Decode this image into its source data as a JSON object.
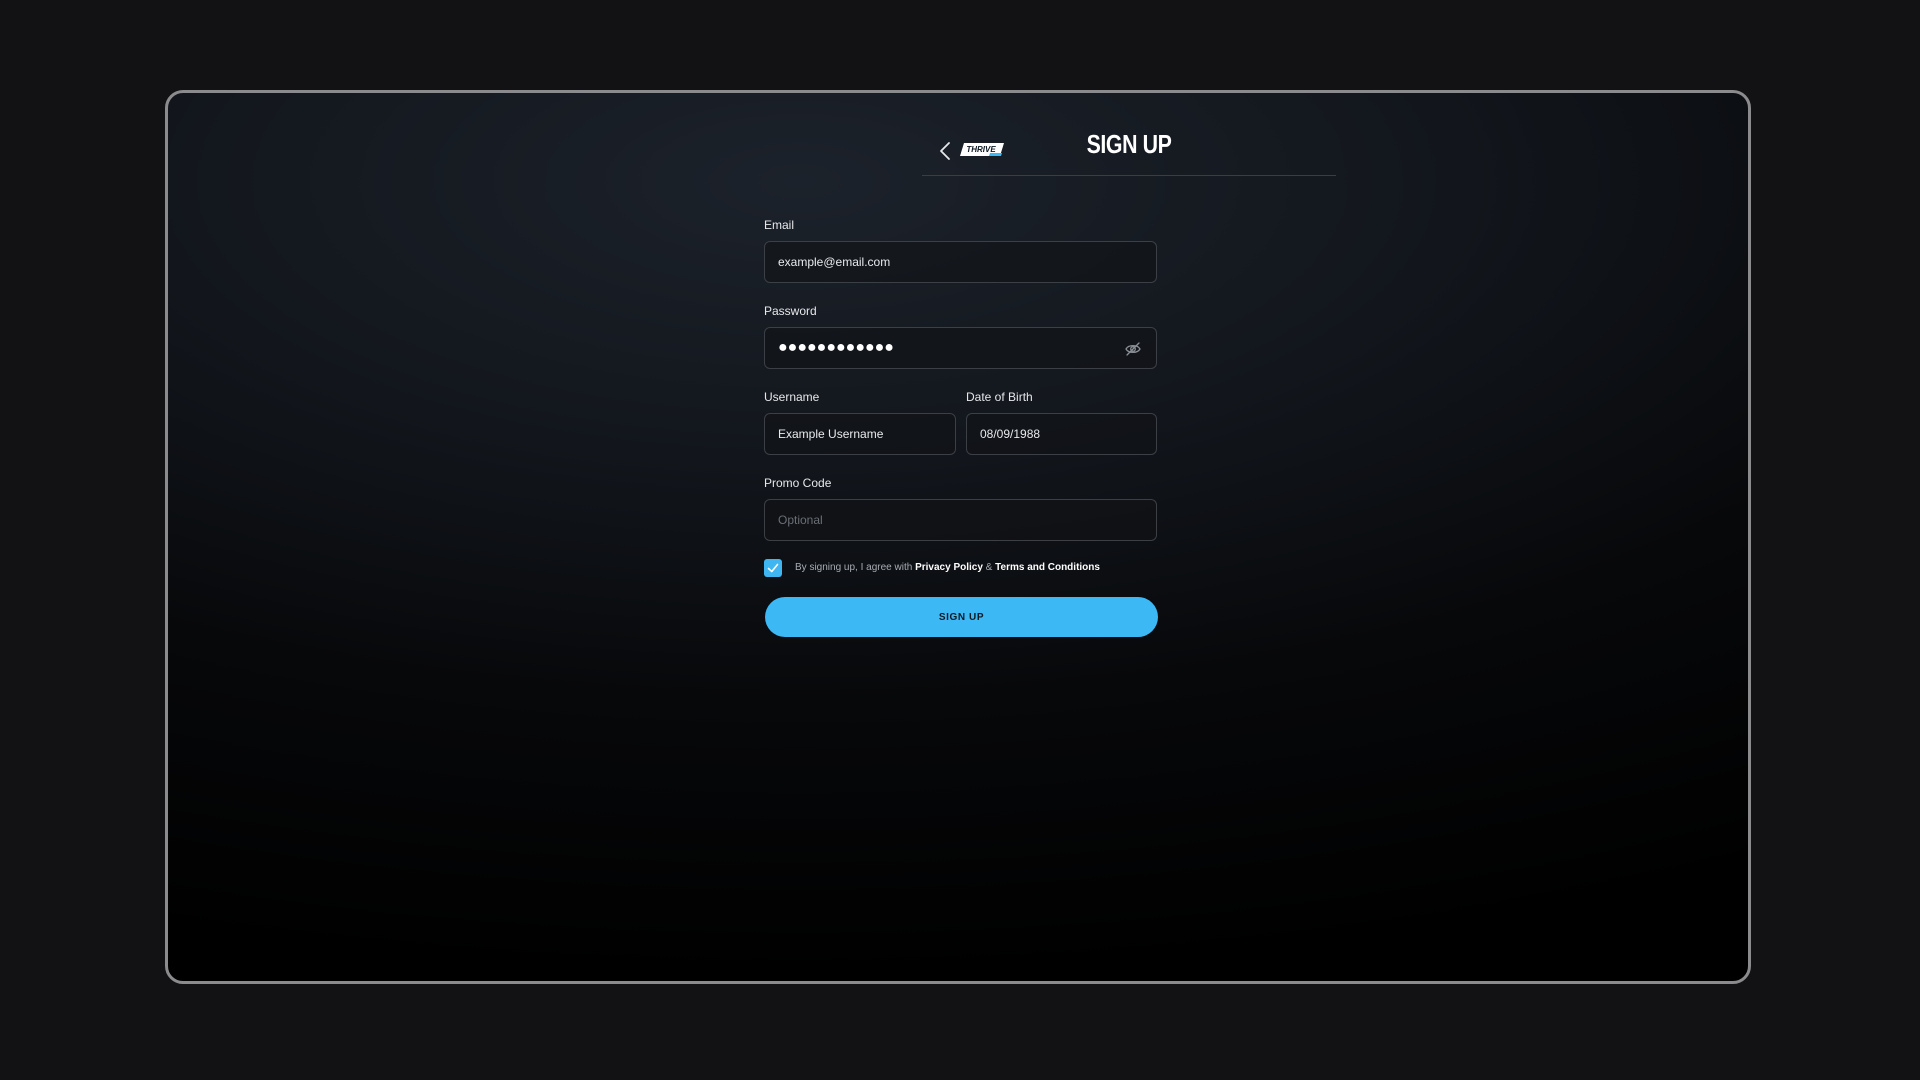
{
  "header": {
    "title": "SIGN UP",
    "logo_text": "THRIVE"
  },
  "form": {
    "email": {
      "label": "Email",
      "value": "example@email.com"
    },
    "password": {
      "label": "Password",
      "masked_value": "●●●●●●●●●●●●"
    },
    "username": {
      "label": "Username",
      "value": "Example Username"
    },
    "dob": {
      "label": "Date of Birth",
      "value": "08/09/1988"
    },
    "promo": {
      "label": "Promo Code",
      "placeholder": "Optional"
    },
    "agreement": {
      "checked": true,
      "prefix": "By signing up, I agree with ",
      "privacy_link": "Privacy Policy",
      "separator": " & ",
      "terms_link": "Terms and Conditions"
    },
    "submit_label": "SIGN UP"
  },
  "colors": {
    "accent": "#3cb8f4",
    "text": "#ffffff",
    "field_border": "#3c3f45"
  },
  "icons": {
    "back": "chevron-left-icon",
    "password_toggle": "eye-off-icon",
    "checkbox": "checkmark-icon"
  }
}
